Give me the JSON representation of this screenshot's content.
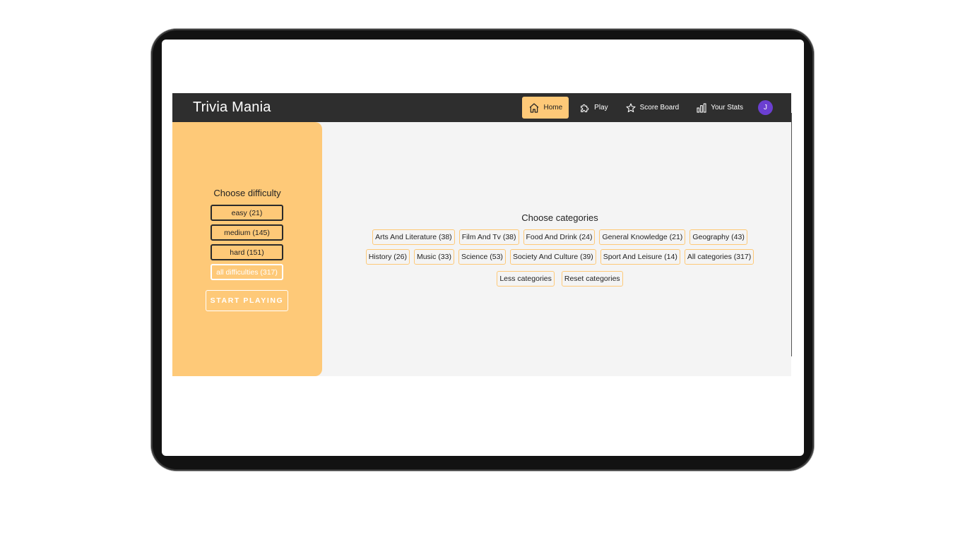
{
  "app": {
    "brand": "Trivia Mania"
  },
  "nav": {
    "items": [
      {
        "label": "Home",
        "icon": "home-icon",
        "active": true
      },
      {
        "label": "Play",
        "icon": "puzzle-icon",
        "active": false
      },
      {
        "label": "Score Board",
        "icon": "star-icon",
        "active": false
      },
      {
        "label": "Your Stats",
        "icon": "bar-chart-icon",
        "active": false
      }
    ],
    "avatar_initial": "J"
  },
  "difficulty": {
    "title": "Choose difficulty",
    "options": [
      {
        "label": "easy (21)"
      },
      {
        "label": "medium (145)"
      },
      {
        "label": "hard (151)"
      },
      {
        "label": "all difficulties (317)",
        "selected": true
      }
    ],
    "start_label": "START PLAYING"
  },
  "categories": {
    "title": "Choose categories",
    "items": [
      {
        "label": "Arts And Literature (38)"
      },
      {
        "label": "Film And Tv (38)"
      },
      {
        "label": "Food And Drink (24)"
      },
      {
        "label": "General Knowledge (21)"
      },
      {
        "label": "Geography (43)"
      },
      {
        "label": "History (26)"
      },
      {
        "label": "Music (33)"
      },
      {
        "label": "Science (53)"
      },
      {
        "label": "Society And Culture (39)"
      },
      {
        "label": "Sport And Leisure (14)"
      },
      {
        "label": "All categories (317)"
      }
    ],
    "less_label": "Less categories",
    "reset_label": "Reset categories"
  },
  "colors": {
    "accent": "#fec978",
    "navbar": "#2e2e2e",
    "avatar": "#6b3fd1",
    "background": "#f4f4f4"
  }
}
